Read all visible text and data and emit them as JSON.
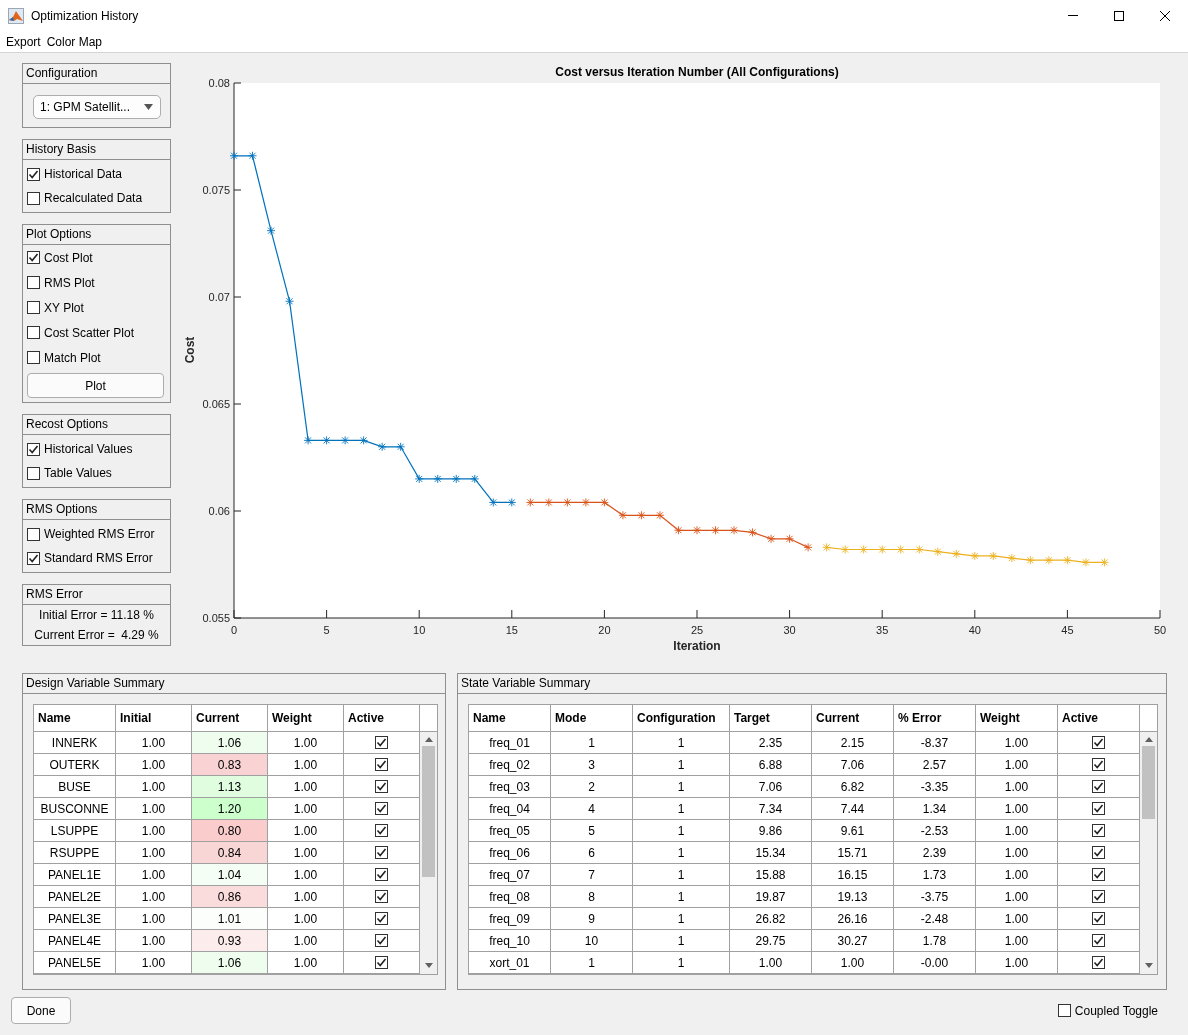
{
  "window": {
    "title": "Optimization History"
  },
  "menu": [
    "Export",
    "Color Map"
  ],
  "configuration": {
    "title": "Configuration",
    "value": "1: GPM Satellit..."
  },
  "option_panels": [
    {
      "title": "History Basis",
      "options": [
        {
          "label": "Historical Data",
          "checked": true
        },
        {
          "label": "Recalculated Data",
          "checked": false
        }
      ]
    },
    {
      "title": "Plot Options",
      "options": [
        {
          "label": "Cost Plot",
          "checked": true
        },
        {
          "label": "RMS Plot",
          "checked": false
        },
        {
          "label": "XY Plot",
          "checked": false
        },
        {
          "label": "Cost Scatter Plot",
          "checked": false
        },
        {
          "label": "Match Plot",
          "checked": false
        }
      ],
      "button": "Plot"
    },
    {
      "title": "Recost Options",
      "options": [
        {
          "label": "Historical Values",
          "checked": true
        },
        {
          "label": "Table Values",
          "checked": false
        }
      ]
    },
    {
      "title": "RMS Options",
      "options": [
        {
          "label": "Weighted RMS Error",
          "checked": false
        },
        {
          "label": "Standard RMS Error",
          "checked": true
        }
      ]
    }
  ],
  "rms_error": {
    "title": "RMS Error",
    "lines": [
      "Initial Error = 11.18 %",
      "Current Error =  4.29 %"
    ]
  },
  "plot": {
    "chart_data": {
      "type": "line",
      "title": "Cost versus Iteration Number (All Configurations)",
      "xlabel": "Iteration",
      "ylabel": "Cost",
      "x": [
        0,
        1,
        2,
        3,
        4,
        5,
        6,
        7,
        8,
        9,
        10,
        11,
        12,
        13,
        14,
        15,
        16,
        17,
        18,
        19,
        20,
        21,
        22,
        23,
        24,
        25,
        26,
        27,
        28,
        29,
        30,
        31,
        32,
        33,
        34,
        35,
        36,
        37,
        38,
        39,
        40,
        41,
        42,
        43,
        44,
        45,
        46,
        47
      ],
      "series": [
        {
          "color": "#0072bd",
          "values": [
            0.0766,
            0.0766,
            0.0731,
            0.0698,
            0.0633,
            0.0633,
            0.0633,
            0.0633,
            0.063,
            0.063,
            0.0615,
            0.0615,
            0.0615,
            0.0615,
            0.0604,
            0.0604,
            null,
            null,
            null,
            null,
            null,
            null,
            null,
            null,
            null,
            null,
            null,
            null,
            null,
            null,
            null,
            null,
            null,
            null,
            null,
            null,
            null,
            null,
            null,
            null,
            null,
            null,
            null,
            null,
            null,
            null,
            null,
            null
          ]
        },
        {
          "color": "#d95319",
          "values": [
            null,
            null,
            null,
            null,
            null,
            null,
            null,
            null,
            null,
            null,
            null,
            null,
            null,
            null,
            null,
            null,
            0.0604,
            0.0604,
            0.0604,
            0.0604,
            0.0604,
            0.0598,
            0.0598,
            0.0598,
            0.0591,
            0.0591,
            0.0591,
            0.0591,
            0.059,
            0.0587,
            0.0587,
            0.0583,
            null,
            null,
            null,
            null,
            null,
            null,
            null,
            null,
            null,
            null,
            null,
            null,
            null,
            null,
            null,
            null
          ]
        },
        {
          "color": "#edb120",
          "values": [
            null,
            null,
            null,
            null,
            null,
            null,
            null,
            null,
            null,
            null,
            null,
            null,
            null,
            null,
            null,
            null,
            null,
            null,
            null,
            null,
            null,
            null,
            null,
            null,
            null,
            null,
            null,
            null,
            null,
            null,
            null,
            null,
            0.0583,
            0.0582,
            0.0582,
            0.0582,
            0.0582,
            0.0582,
            0.0581,
            0.058,
            0.0579,
            0.0579,
            0.0578,
            0.0577,
            0.0577,
            0.0577,
            0.0576,
            0.0576
          ]
        }
      ],
      "xlim": [
        0,
        50
      ],
      "ylim": [
        0.055,
        0.08
      ],
      "xticks": [
        0,
        5,
        10,
        15,
        20,
        25,
        30,
        35,
        40,
        45,
        50
      ],
      "yticks": [
        0.055,
        0.06,
        0.065,
        0.07,
        0.075,
        0.08
      ]
    }
  },
  "design_table": {
    "title": "Design Variable Summary",
    "columns": [
      "Name",
      "Initial",
      "Current",
      "Weight",
      "Active"
    ],
    "rows": [
      {
        "name": "INNERK",
        "initial": "1.00",
        "current": "1.06",
        "weight": "1.00",
        "active": true,
        "color": "#effdef"
      },
      {
        "name": "OUTERK",
        "initial": "1.00",
        "current": "0.83",
        "weight": "1.00",
        "active": true,
        "color": "#f9d3d3"
      },
      {
        "name": "BUSE",
        "initial": "1.00",
        "current": "1.13",
        "weight": "1.00",
        "active": true,
        "color": "#e0fde0"
      },
      {
        "name": "BUSCONNE",
        "initial": "1.00",
        "current": "1.20",
        "weight": "1.00",
        "active": true,
        "color": "#ccffcc"
      },
      {
        "name": "LSUPPE",
        "initial": "1.00",
        "current": "0.80",
        "weight": "1.00",
        "active": true,
        "color": "#fbcccc"
      },
      {
        "name": "RSUPPE",
        "initial": "1.00",
        "current": "0.84",
        "weight": "1.00",
        "active": true,
        "color": "#f9d6d6"
      },
      {
        "name": "PANEL1E",
        "initial": "1.00",
        "current": "1.04",
        "weight": "1.00",
        "active": true,
        "color": "#f4fef4"
      },
      {
        "name": "PANEL2E",
        "initial": "1.00",
        "current": "0.86",
        "weight": "1.00",
        "active": true,
        "color": "#fadcdc"
      },
      {
        "name": "PANEL3E",
        "initial": "1.00",
        "current": "1.01",
        "weight": "1.00",
        "active": true,
        "color": "#fcfefc"
      },
      {
        "name": "PANEL4E",
        "initial": "1.00",
        "current": "0.93",
        "weight": "1.00",
        "active": true,
        "color": "#fcecec"
      },
      {
        "name": "PANEL5E",
        "initial": "1.00",
        "current": "1.06",
        "weight": "1.00",
        "active": true,
        "color": "#effdef"
      }
    ]
  },
  "state_table": {
    "title": "State Variable Summary",
    "columns": [
      "Name",
      "Mode",
      "Configuration",
      "Target",
      "Current",
      "% Error",
      "Weight",
      "Active"
    ],
    "rows": [
      {
        "name": "freq_01",
        "mode": "1",
        "configuration": "1",
        "target": "2.35",
        "current": "2.15",
        "error": "-8.37",
        "weight": "1.00",
        "active": true
      },
      {
        "name": "freq_02",
        "mode": "3",
        "configuration": "1",
        "target": "6.88",
        "current": "7.06",
        "error": "2.57",
        "weight": "1.00",
        "active": true
      },
      {
        "name": "freq_03",
        "mode": "2",
        "configuration": "1",
        "target": "7.06",
        "current": "6.82",
        "error": "-3.35",
        "weight": "1.00",
        "active": true
      },
      {
        "name": "freq_04",
        "mode": "4",
        "configuration": "1",
        "target": "7.34",
        "current": "7.44",
        "error": "1.34",
        "weight": "1.00",
        "active": true
      },
      {
        "name": "freq_05",
        "mode": "5",
        "configuration": "1",
        "target": "9.86",
        "current": "9.61",
        "error": "-2.53",
        "weight": "1.00",
        "active": true
      },
      {
        "name": "freq_06",
        "mode": "6",
        "configuration": "1",
        "target": "15.34",
        "current": "15.71",
        "error": "2.39",
        "weight": "1.00",
        "active": true
      },
      {
        "name": "freq_07",
        "mode": "7",
        "configuration": "1",
        "target": "15.88",
        "current": "16.15",
        "error": "1.73",
        "weight": "1.00",
        "active": true
      },
      {
        "name": "freq_08",
        "mode": "8",
        "configuration": "1",
        "target": "19.87",
        "current": "19.13",
        "error": "-3.75",
        "weight": "1.00",
        "active": true
      },
      {
        "name": "freq_09",
        "mode": "9",
        "configuration": "1",
        "target": "26.82",
        "current": "26.16",
        "error": "-2.48",
        "weight": "1.00",
        "active": true
      },
      {
        "name": "freq_10",
        "mode": "10",
        "configuration": "1",
        "target": "29.75",
        "current": "30.27",
        "error": "1.78",
        "weight": "1.00",
        "active": true
      },
      {
        "name": "xort_01",
        "mode": "1",
        "configuration": "1",
        "target": "1.00",
        "current": "1.00",
        "error": "-0.00",
        "weight": "1.00",
        "active": true
      }
    ]
  },
  "footer": {
    "done_button": "Done",
    "coupled_toggle": {
      "label": "Coupled Toggle",
      "checked": false
    }
  }
}
